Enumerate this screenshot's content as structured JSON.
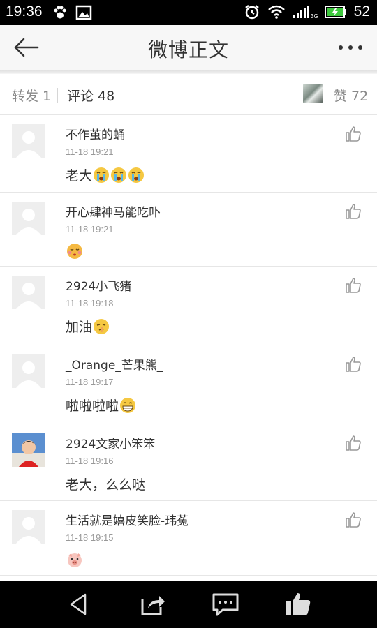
{
  "statusbar": {
    "time": "19:36",
    "battery": "52",
    "network": "3G"
  },
  "header": {
    "title": "微博正文"
  },
  "tabs": {
    "repost": "转发 1",
    "comments": "评论 48",
    "likes": "赞 72"
  },
  "comments": [
    {
      "name": "不作茧的蛹",
      "time": "11-18 19:21",
      "text": "老大",
      "emojis": [
        "crying-face",
        "crying-face",
        "crying-face"
      ],
      "avatar": "default"
    },
    {
      "name": "开心肆神马能吃卟",
      "time": "11-18 19:21",
      "text": "",
      "emojis": [
        "kissing-face"
      ],
      "avatar": "default"
    },
    {
      "name": "2924小飞猪",
      "time": "11-18 19:18",
      "text": "加油",
      "emojis": [
        "shushing-face"
      ],
      "avatar": "default"
    },
    {
      "name": "_Orange_芒果熊_",
      "time": "11-18 19:17",
      "text": "啦啦啦啦",
      "emojis": [
        "grinning-face"
      ],
      "avatar": "default"
    },
    {
      "name": "2924文家小笨笨",
      "time": "11-18 19:16",
      "text": "老大，么么哒",
      "emojis": [],
      "avatar": "photo"
    },
    {
      "name": "生活就是嬉皮笑脸-玮菟",
      "time": "11-18 19:15",
      "text": "",
      "emojis": [
        "pig-face"
      ],
      "avatar": "default"
    }
  ],
  "colors": {
    "header_bg": "#f7f7f7",
    "status_bg": "#000000",
    "nav_bg": "#000000",
    "text": "#333333",
    "muted": "#999999"
  }
}
